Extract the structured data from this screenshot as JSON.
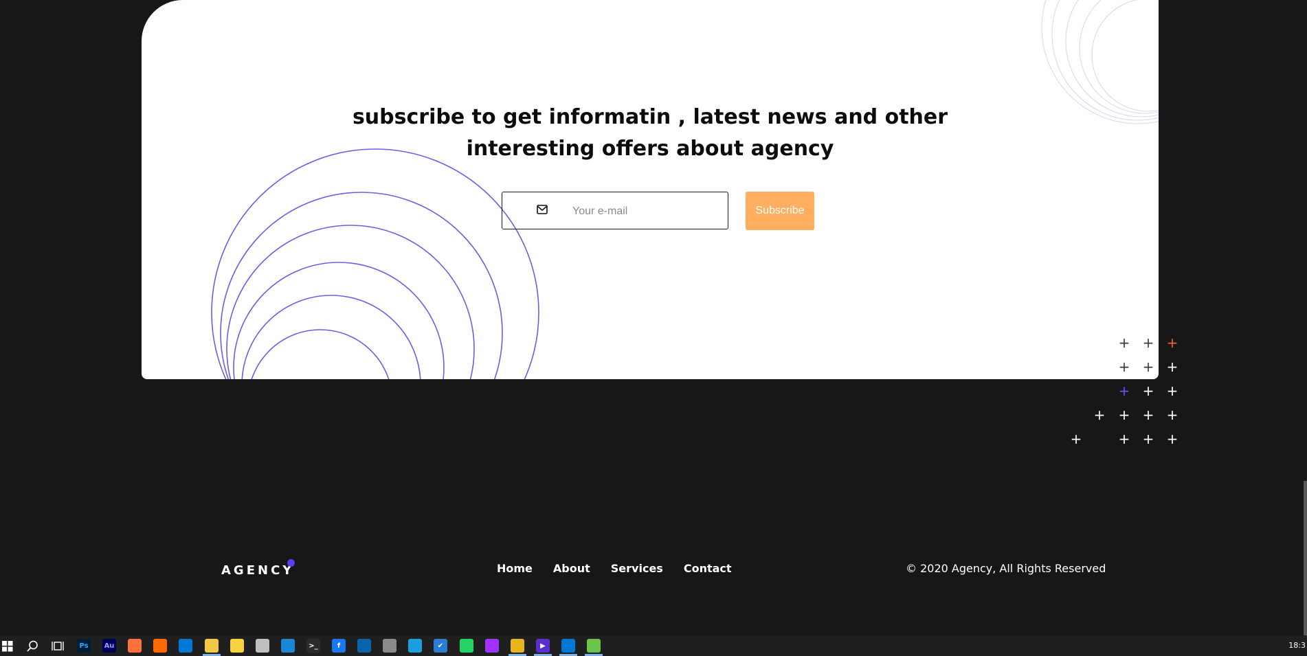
{
  "subscribe": {
    "heading_line1": "subscribe to get informatin , latest news and other",
    "heading_line2": "interesting offers about agency",
    "email_placeholder": "Your e-mail",
    "button_label": "Subscribe"
  },
  "footer": {
    "logo": "AGENCY",
    "nav": [
      "Home",
      "About",
      "Services",
      "Contact"
    ],
    "copyright": "© 2020 Agency, All Rights Reserved"
  },
  "taskbar": {
    "clock": "18:3",
    "apps": [
      {
        "name": "photoshop-icon",
        "label": "Ps",
        "color": "#001e36",
        "fg": "#31a8ff"
      },
      {
        "name": "audition-icon",
        "label": "Au",
        "color": "#00005b",
        "fg": "#9999ff"
      },
      {
        "name": "firefox-icon",
        "label": "",
        "color": "#ff7139",
        "fg": "#fff"
      },
      {
        "name": "search-tool-icon",
        "label": "",
        "color": "#ff6a00",
        "fg": "#fff"
      },
      {
        "name": "blue-app-icon",
        "label": "",
        "color": "#0078d4",
        "fg": "#fff"
      },
      {
        "name": "file-explorer-icon",
        "label": "",
        "color": "#f3c846",
        "fg": "#fff"
      },
      {
        "name": "sticky-notes-icon",
        "label": "",
        "color": "#f7d23d",
        "fg": "#fff"
      },
      {
        "name": "clock-app-icon",
        "label": "",
        "color": "#bfbfbf",
        "fg": "#fff"
      },
      {
        "name": "webstorm-icon",
        "label": "",
        "color": "#1a86d6",
        "fg": "#fff"
      },
      {
        "name": "terminal-icon",
        "label": ">_",
        "color": "#2b2b2b",
        "fg": "#fff"
      },
      {
        "name": "facebook-icon",
        "label": "f",
        "color": "#1877f2",
        "fg": "#fff"
      },
      {
        "name": "outlook-icon",
        "label": "",
        "color": "#0a64ad",
        "fg": "#fff"
      },
      {
        "name": "photos-icon",
        "label": "",
        "color": "#8a8a8a",
        "fg": "#fff"
      },
      {
        "name": "edge-icon",
        "label": "",
        "color": "#1a9ede",
        "fg": "#fff"
      },
      {
        "name": "todo-icon",
        "label": "✔",
        "color": "#2b7cd3",
        "fg": "#fff"
      },
      {
        "name": "whatsapp-icon",
        "label": "",
        "color": "#25d366",
        "fg": "#fff"
      },
      {
        "name": "messenger-icon",
        "label": "",
        "color": "#a033ff",
        "fg": "#fff"
      },
      {
        "name": "chrome-icon",
        "label": "",
        "color": "#e8b31d",
        "fg": "#fff"
      },
      {
        "name": "media-player-icon",
        "label": "▶",
        "color": "#5b2dd1",
        "fg": "#fff"
      },
      {
        "name": "vscode-icon",
        "label": "",
        "color": "#0078d7",
        "fg": "#fff"
      },
      {
        "name": "clover-icon",
        "label": "",
        "color": "#6cc24a",
        "fg": "#fff"
      }
    ]
  },
  "colors": {
    "background": "#171717",
    "accent": "#ffad5e",
    "purple": "#5b3df5"
  }
}
